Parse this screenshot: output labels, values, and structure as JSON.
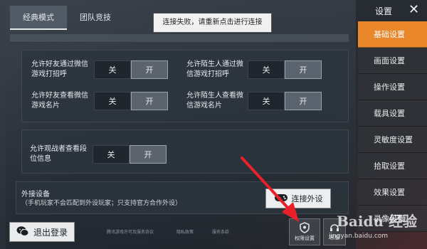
{
  "mode_tabs": [
    "经典模式",
    "团队竞技"
  ],
  "toast": "连接失败，请重新点击进行连接",
  "settings_title": "设置",
  "close_icon": "close-icon",
  "toggle_labels": {
    "off": "关",
    "on": "开"
  },
  "options": [
    {
      "label": "允许好友通过微信游戏打招呼",
      "state": "off"
    },
    {
      "label": "允许陌生人通过微信游戏打招呼",
      "state": "off"
    },
    {
      "label": "允许好友查看微信游戏名片",
      "state": "off"
    },
    {
      "label": "允许陌生人查看微信游戏名片",
      "state": "off"
    },
    {
      "label": "允许观战者查看段位信息",
      "state": "off"
    }
  ],
  "external": {
    "title": "外接设备",
    "desc": "（手机玩家不会匹配到外设玩家；只支持官方合作外设）",
    "connect_label": "连接外设"
  },
  "logout_label": "退出登录",
  "footer_links": [
    "腾讯游戏许可及服务协议",
    "隐私政策",
    "服务条款"
  ],
  "bottom_buttons": [
    {
      "label": "权限设置",
      "icon": "shield-icon"
    },
    {
      "label": "客服",
      "icon": "headset-icon"
    }
  ],
  "side_menu": [
    "基础设置",
    "画面设置",
    "操作设置",
    "载具设置",
    "灵敏度设置",
    "拾取设置",
    "效果设置",
    "录像设置"
  ],
  "side_active": 0,
  "watermark": "Baidu 经验",
  "watermark_url": "jingyan.baidu.com",
  "colors": {
    "accent": "#e9872a",
    "arrow": "#e8202a"
  }
}
